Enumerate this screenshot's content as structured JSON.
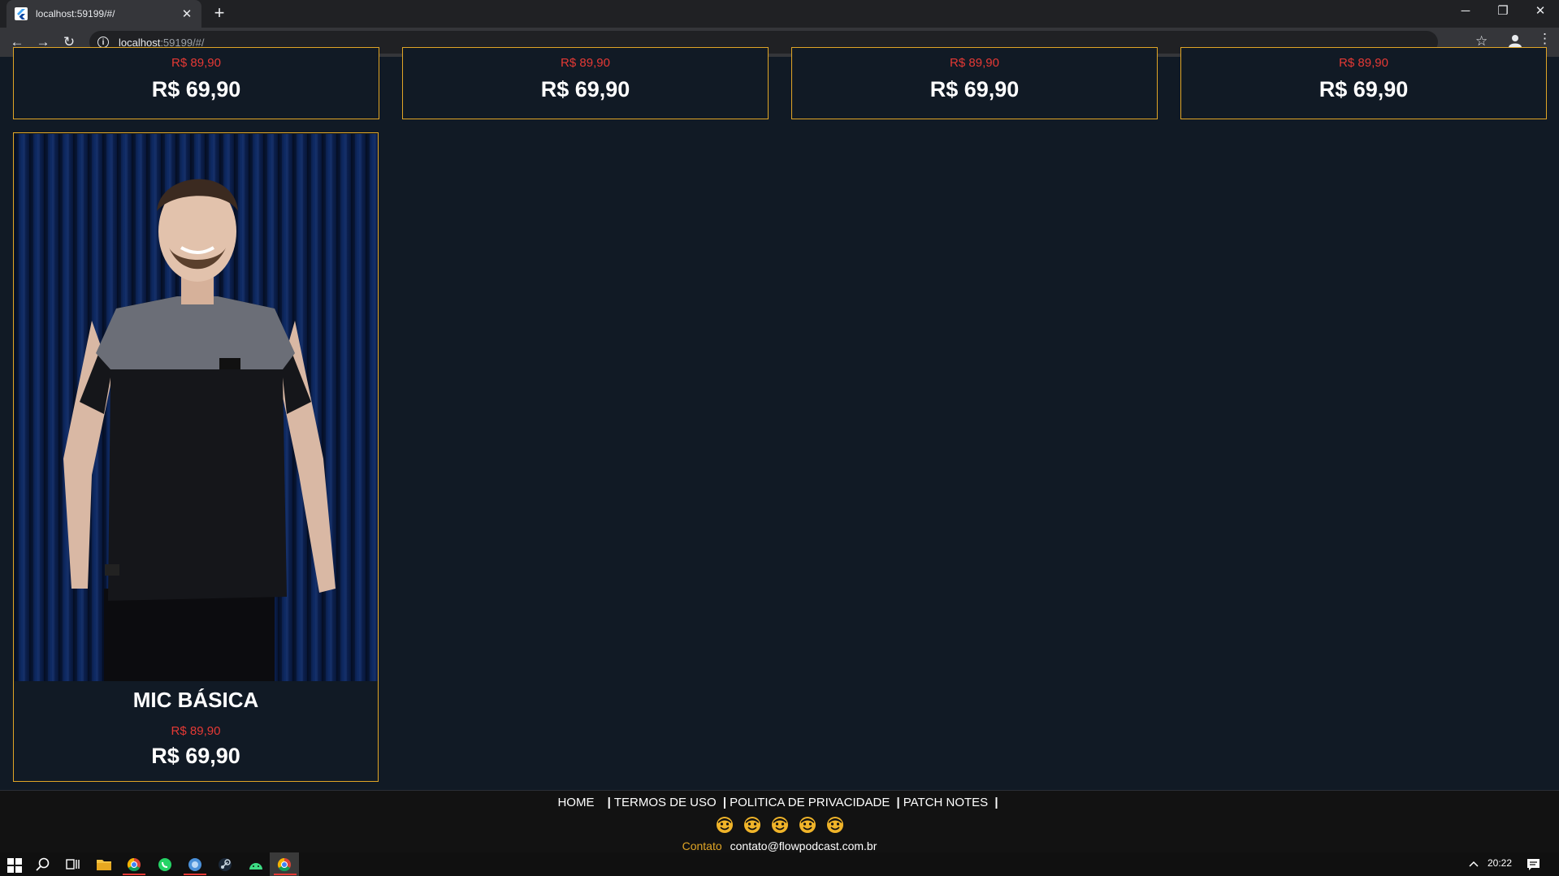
{
  "browser": {
    "tab_title": "localhost:59199/#/",
    "url_host": "localhost",
    "url_rest": ":59199/#/",
    "favicon": "flutter-icon",
    "close_glyph": "✕",
    "new_tab_glyph": "+",
    "minimize_glyph": "─",
    "restore_glyph": "❐",
    "window_close_glyph": "✕",
    "back_glyph": "←",
    "forward_glyph": "→",
    "reload_glyph": "↻",
    "info_glyph": "i",
    "star_glyph": "☆",
    "menu_glyph": "⋮"
  },
  "products": [
    {
      "old_price": "R$ 89,90",
      "price": "R$ 69,90"
    },
    {
      "old_price": "R$ 89,90",
      "price": "R$ 69,90"
    },
    {
      "old_price": "R$ 89,90",
      "price": "R$ 69,90"
    },
    {
      "old_price": "R$ 89,90",
      "price": "R$ 69,90"
    },
    {
      "name": "MIC BÁSICA",
      "old_price": "R$ 89,90",
      "price": "R$ 69,90",
      "image": "man-black-grey-tshirt"
    }
  ],
  "footer": {
    "links": [
      "HOME",
      "TERMOS DE USO",
      "POLITICA DE PRIVACIDADE",
      "PATCH NOTES"
    ],
    "separator": "|",
    "social_icons": [
      "flow-face-icon",
      "flow-face-icon",
      "flow-face-icon",
      "flow-face-icon",
      "flow-face-icon"
    ],
    "contact_label": "Contato",
    "contact_email": "contato@flowpodcast.com.br"
  },
  "taskbar": {
    "clock": "20:22"
  },
  "colors": {
    "accent": "#e0a526",
    "old_price": "#e53935",
    "background": "#111a25"
  }
}
